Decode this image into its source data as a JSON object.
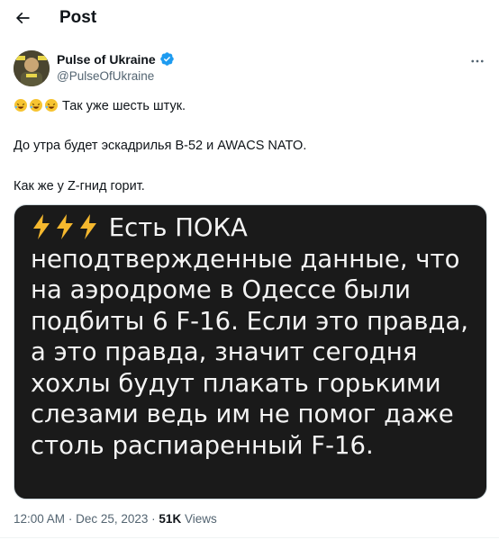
{
  "header": {
    "title": "Post",
    "back_icon": "arrow-left-icon"
  },
  "author": {
    "name": "Pulse of Ukraine",
    "handle": "@PulseOfUkraine",
    "verified_color": "#1d9bf0",
    "more_icon": "more-horizontal-icon"
  },
  "tweet": {
    "line1_emoji": "rolling-on-floor-laughing-icon",
    "line1": "Так уже шесть штук.",
    "line2": "До утра будет эскадрилья B-52 и AWACS NATO.",
    "line3": "Как же у Z-гнид горит."
  },
  "media": {
    "lines": [
      "Есть ПОКА",
      "неподтвержденные данные, что",
      "на аэродроме в Одессе были",
      "подбиты 6 F-16. Если это правда,",
      "а это правда, значит сегодня",
      "хохлы будут плакать горькими",
      "слезами ведь им не помог даже",
      "столь распиаренный F-16."
    ],
    "prefix_icon": "high-voltage-icon",
    "background": "#1a1a1a",
    "text_color": "#f4f4f4"
  },
  "meta": {
    "time": "12:00 AM",
    "sep1": "·",
    "date": "Dec 25, 2023",
    "sep2": "·",
    "views_count": "51K",
    "views_label": "Views"
  }
}
